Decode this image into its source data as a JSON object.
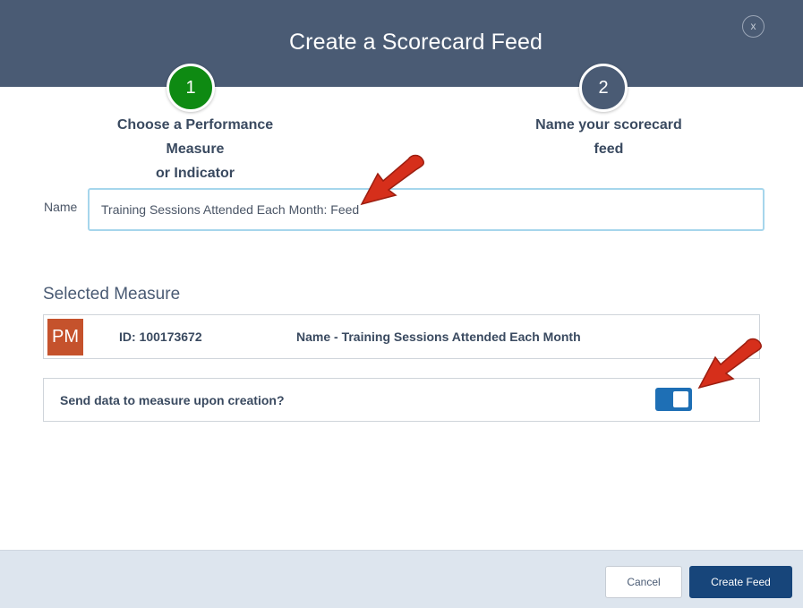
{
  "dialog": {
    "title": "Create a Scorecard Feed",
    "close_label": "x"
  },
  "steps": [
    {
      "number": "1",
      "label_line1": "Choose a Performance Measure",
      "label_line2": "or Indicator",
      "color": "#0e8a12"
    },
    {
      "number": "2",
      "label_line1": "Name your scorecard",
      "label_line2": "feed",
      "color": "#4a5b74"
    }
  ],
  "form": {
    "name_label": "Name",
    "name_value": "Training Sessions Attended Each Month: Feed"
  },
  "selected_measure": {
    "section_title": "Selected Measure",
    "badge": "PM",
    "id_text": "ID: 100173672",
    "name_text": "Name - Training Sessions Attended Each Month"
  },
  "send_data": {
    "label": "Send data to measure upon creation?",
    "enabled": true
  },
  "footer": {
    "cancel_label": "Cancel",
    "create_label": "Create Feed"
  },
  "colors": {
    "header": "#4a5b74",
    "step_complete": "#0e8a12",
    "badge": "#c5522c",
    "toggle_on": "#1e6fb5",
    "primary_button": "#17457a",
    "annotation_arrow": "#d62f1b"
  }
}
